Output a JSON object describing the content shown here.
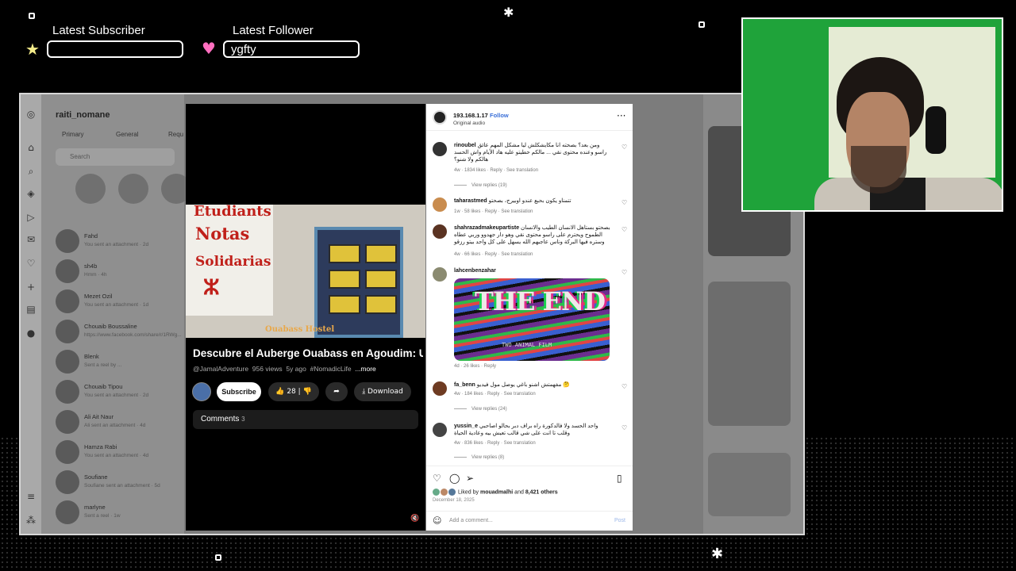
{
  "overlay": {
    "latest_subscriber_label": "Latest Subscriber",
    "latest_subscriber_value": "",
    "latest_follower_label": "Latest Follower",
    "latest_follower_value": "ygfty"
  },
  "instagram_bg": {
    "username": "raiti_nomane",
    "tabs": [
      "Primary",
      "General",
      "Requ"
    ],
    "search_placeholder": "Search",
    "conversations": [
      {
        "name": "Fahd",
        "sub": "You sent an attachment · 2d"
      },
      {
        "name": "sh4b",
        "sub": "Hmm · 4h"
      },
      {
        "name": "Mezet Ozil",
        "sub": "You sent an attachment · 1d"
      },
      {
        "name": "Chouaib Boussaline",
        "sub": "https://www.facebook.com/share/r/1RWg..."
      },
      {
        "name": "Blenk",
        "sub": "Sent a reel by ..."
      },
      {
        "name": "Chouaib Tipou",
        "sub": "You sent an attachment · 2d"
      },
      {
        "name": "Ali Ait Naur",
        "sub": "Ali sent an attachment · 4d"
      },
      {
        "name": "Hamza Rabi",
        "sub": "You sent an attachment · 4d"
      },
      {
        "name": "Soufiane",
        "sub": "Soufiane sent an attachment · 5d"
      },
      {
        "name": "marlyne",
        "sub": "Sent a reel · 1w"
      }
    ]
  },
  "video": {
    "title": "Descubre el Auberge Ouabass en Agoudim: Un...",
    "channel": "@JamalAdventure",
    "views": "956 views",
    "age": "5y ago",
    "hashtag": "#NomadicLife",
    "more": "...more",
    "subscribe": "Subscribe",
    "likes": "28",
    "download": "Download",
    "comments_label": "Comments",
    "comments_count": "3",
    "thumb_text_1": "Etudiants",
    "thumb_text_2": "Notas",
    "thumb_text_3": "Solidarias",
    "watermark": "Ouabass Hostel"
  },
  "post": {
    "username": "193.168.1.17",
    "follow": "Follow",
    "audio": "Original audio",
    "comments": [
      {
        "user": "rinoubel",
        "text": "ومن بعد؟ بصحته انا مكايشكلش ليا مشكل المهم عائق راسو وعنده محتوى نقي ... مالكم حطيتو عليه هاد الأيام واش الحسد هالكم ولا شنو؟",
        "meta": "4w · 1834 likes · Reply · See translation",
        "replies": "View replies (19)"
      },
      {
        "user": "taharastmed",
        "text": "تتمناو يكون بحبع عندو اوبيرج، بصحتو",
        "meta": "1w · 58 likes · Reply · See translation",
        "replies": ""
      },
      {
        "user": "shahrazadmakeupartiste",
        "text": "بصحتو بستاهل الانسان الطيب والانسان الطموح ويحترم على راسو محتوى نقي وهو دار جهدوو وربي عطاه وستره فيها البركة وناس عاجبهم الله يسهل على كل واحد بيتو رزقو",
        "meta": "4w · 66 likes · Reply · See translation",
        "replies": ""
      },
      {
        "user": "lahcenbenzahar",
        "text": "",
        "meta": "4d · 26 likes · Reply",
        "replies": ""
      },
      {
        "user": "fa_benn",
        "text": "مفهمتش اشنو باغي يوصل مول فيديو 🤔",
        "meta": "4w · 184 likes · Reply · See translation",
        "replies": "View replies (24)"
      },
      {
        "user": "yussin_e",
        "text": "واحد الحسد ولا فالدكورة راه براف دبر بحالو اصاحبي وقلب تا انت على شي قالب تعيش بيه وعادية الحياة",
        "meta": "4w · 836 likes · Reply · See translation",
        "replies": "View replies (8)"
      }
    ],
    "gif_text": "THE END",
    "gif_sub": "TWO ANIMAL FILM",
    "liked_by_user": "mouadmalhi",
    "liked_by_others": "8,421 others",
    "liked_prefix": "Liked by",
    "liked_and": "and",
    "date": "December 18, 2025",
    "add_comment_placeholder": "Add a comment...",
    "post_button": "Post"
  }
}
